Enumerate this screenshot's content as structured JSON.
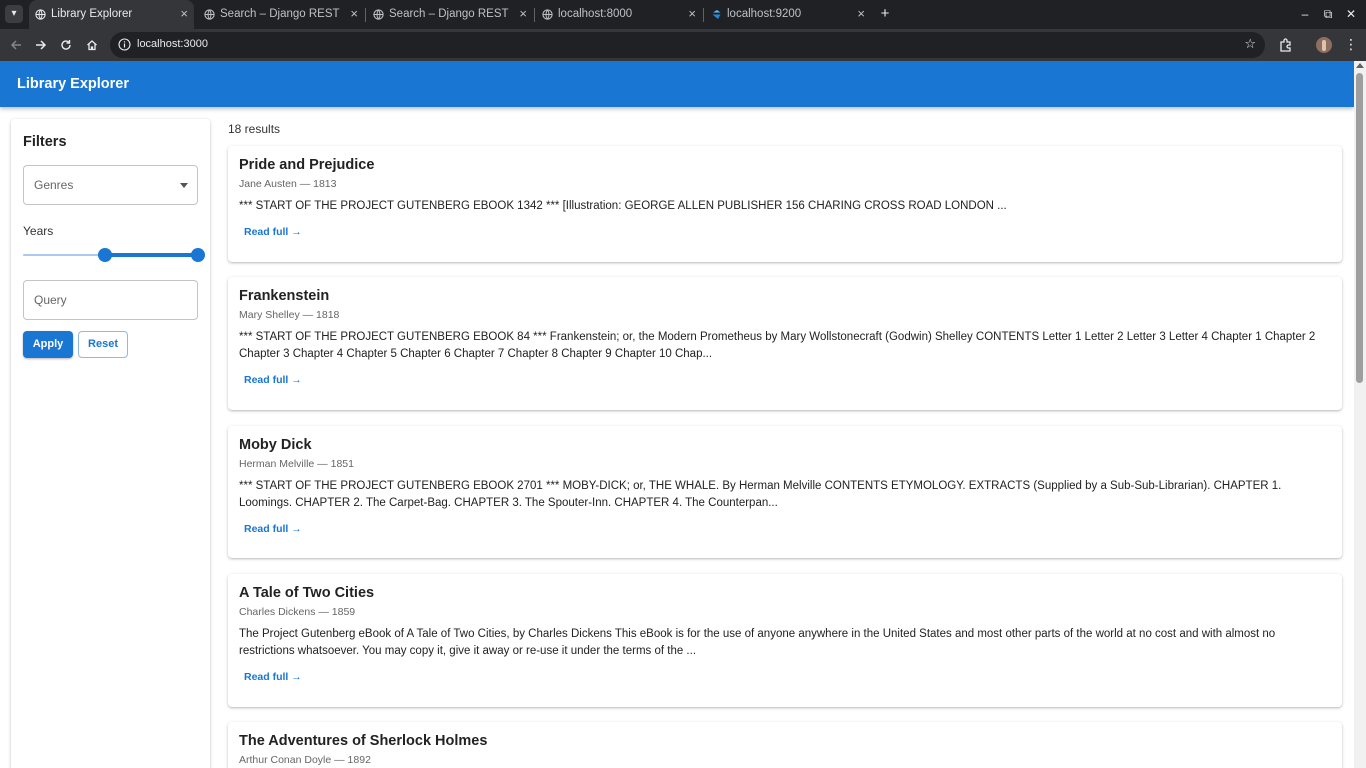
{
  "browser": {
    "tabs": [
      {
        "title": "Library Explorer",
        "active": true
      },
      {
        "title": "Search – Django REST fra",
        "active": false
      },
      {
        "title": "Search – Django REST fra",
        "active": false
      },
      {
        "title": "localhost:8000",
        "active": false
      },
      {
        "title": "localhost:9200",
        "active": false
      }
    ],
    "new_tab": "+",
    "close_glyph": "×",
    "url": "localhost:3000",
    "window_controls": [
      "–",
      "⧉",
      "✕"
    ]
  },
  "app": {
    "title": "Library Explorer",
    "accent_color": "#1976d2"
  },
  "filters": {
    "title": "Filters",
    "genres_label": "Genres",
    "years_label": "Years",
    "years_range_fraction": [
      0.47,
      1.0
    ],
    "query_placeholder": "Query",
    "apply_label": "Apply",
    "reset_label": "Reset"
  },
  "results": {
    "count_text": "18 results",
    "read_more": "Read full →",
    "items": [
      {
        "title": "Pride and Prejudice",
        "meta": "Jane Austen — 1813",
        "snippet": "*** START OF THE PROJECT GUTENBERG EBOOK 1342 *** [Illustration: GEORGE ALLEN PUBLISHER 156 CHARING CROSS ROAD LONDON ..."
      },
      {
        "title": "Frankenstein",
        "meta": "Mary Shelley — 1818",
        "snippet": "*** START OF THE PROJECT GUTENBERG EBOOK 84 *** Frankenstein; or, the Modern Prometheus by Mary Wollstonecraft (Godwin) Shelley CONTENTS Letter 1 Letter 2 Letter 3 Letter 4 Chapter 1 Chapter 2 Chapter 3 Chapter 4 Chapter 5 Chapter 6 Chapter 7 Chapter 8 Chapter 9 Chapter 10 Chap..."
      },
      {
        "title": "Moby Dick",
        "meta": "Herman Melville — 1851",
        "snippet": "*** START OF THE PROJECT GUTENBERG EBOOK 2701 *** MOBY-DICK; or, THE WHALE. By Herman Melville CONTENTS ETYMOLOGY. EXTRACTS (Supplied by a Sub-Sub-Librarian). CHAPTER 1. Loomings. CHAPTER 2. The Carpet-Bag. CHAPTER 3. The Spouter-Inn. CHAPTER 4. The Counterpan..."
      },
      {
        "title": "A Tale of Two Cities",
        "meta": "Charles Dickens — 1859",
        "snippet": "The Project Gutenberg eBook of A Tale of Two Cities, by Charles Dickens This eBook is for the use of anyone anywhere in the United States and most other parts of the world at no cost and with almost no restrictions whatsoever. You may copy it, give it away or re-use it under the terms of the ..."
      },
      {
        "title": "The Adventures of Sherlock Holmes",
        "meta": "Arthur Conan Doyle — 1892",
        "snippet": ""
      }
    ]
  }
}
